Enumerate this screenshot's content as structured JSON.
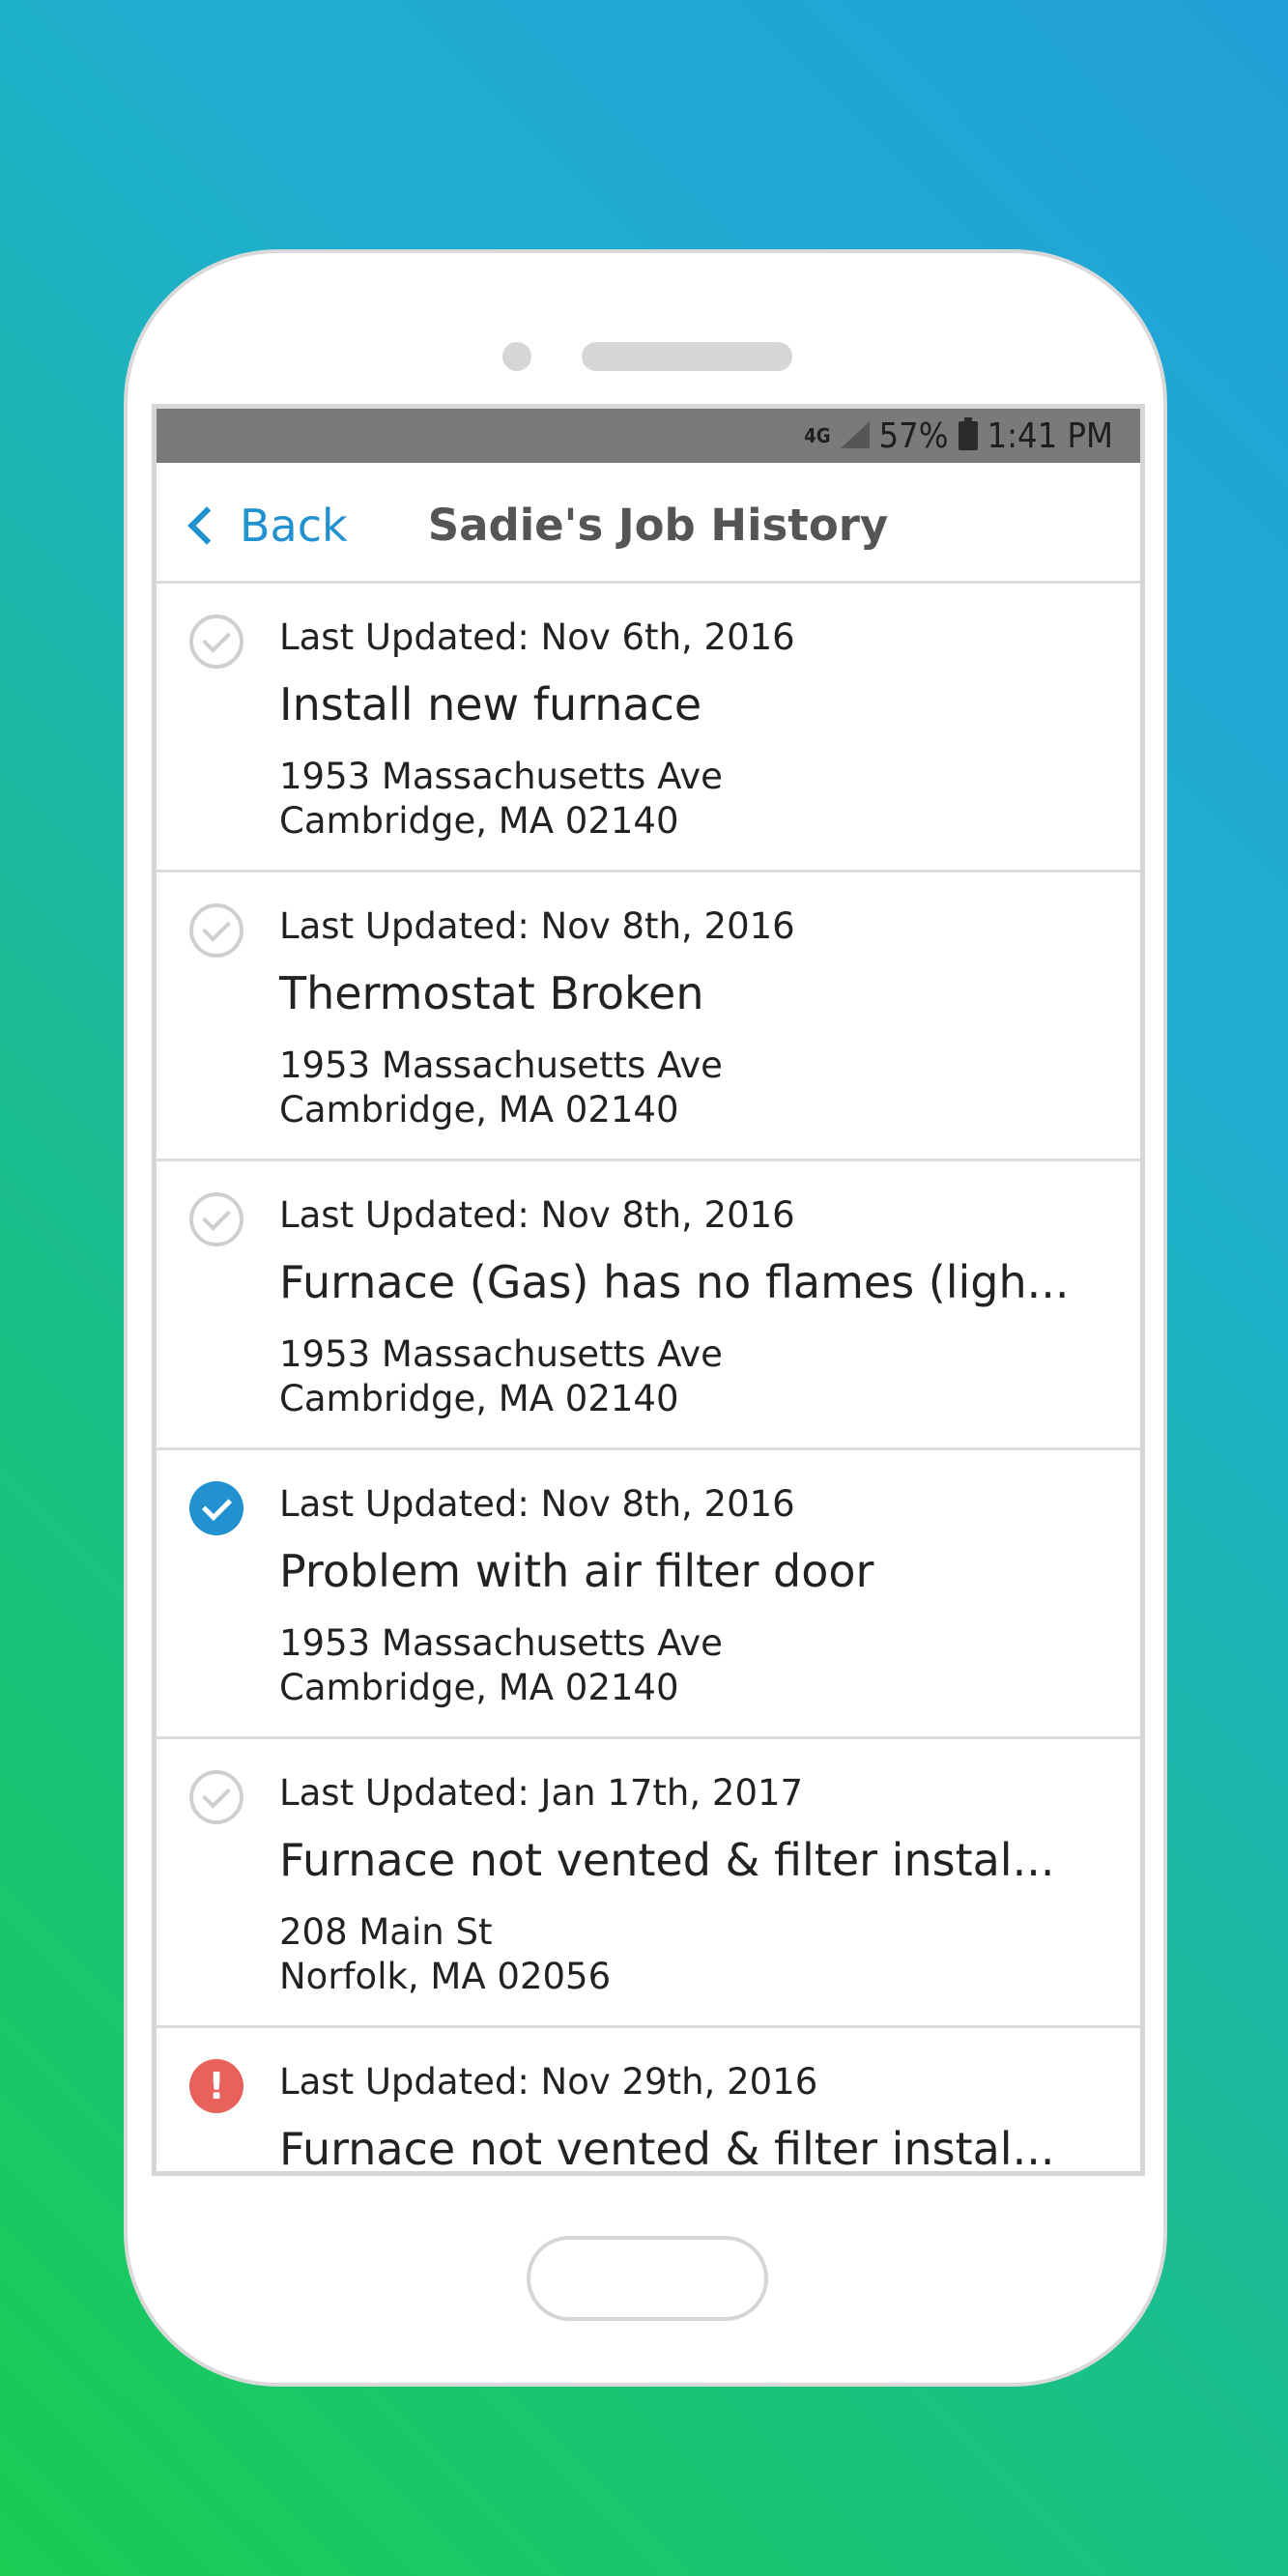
{
  "status_bar": {
    "network": "4G",
    "battery": "57%",
    "time": "1:41 PM"
  },
  "nav": {
    "back_label": "Back",
    "title": "Sadie's Job History"
  },
  "jobs": [
    {
      "status": "done",
      "updated": "Last Updated: Nov 6th, 2016",
      "title": "Install new furnace",
      "address1": "1953 Massachusetts Ave",
      "address2": "Cambridge, MA 02140"
    },
    {
      "status": "done",
      "updated": "Last Updated: Nov 8th, 2016",
      "title": "Thermostat Broken",
      "address1": "1953 Massachusetts Ave",
      "address2": "Cambridge, MA 02140"
    },
    {
      "status": "done",
      "updated": "Last Updated: Nov 8th, 2016",
      "title": "Furnace (Gas) has no flames (ligh...",
      "address1": "1953 Massachusetts Ave",
      "address2": "Cambridge, MA 02140"
    },
    {
      "status": "active",
      "updated": "Last Updated: Nov 8th, 2016",
      "title": "Problem with air filter door",
      "address1": "1953 Massachusetts Ave",
      "address2": "Cambridge, MA 02140"
    },
    {
      "status": "done",
      "updated": "Last Updated: Jan 17th, 2017",
      "title": "Furnace not vented & filter instal...",
      "address1": "208 Main St",
      "address2": "Norfolk, MA 02056"
    },
    {
      "status": "alert",
      "updated": "Last Updated: Nov 29th, 2016",
      "title": "Furnace not vented & filter instal...",
      "address1": "",
      "address2": ""
    }
  ],
  "icons": {
    "done": "check-circle-outline-icon",
    "active": "check-circle-filled-icon",
    "alert": "exclamation-circle-icon",
    "alert_glyph": "!"
  },
  "colors": {
    "accent": "#2291cf",
    "alert": "#e8615a",
    "done_icon": "#cfcfcf"
  }
}
